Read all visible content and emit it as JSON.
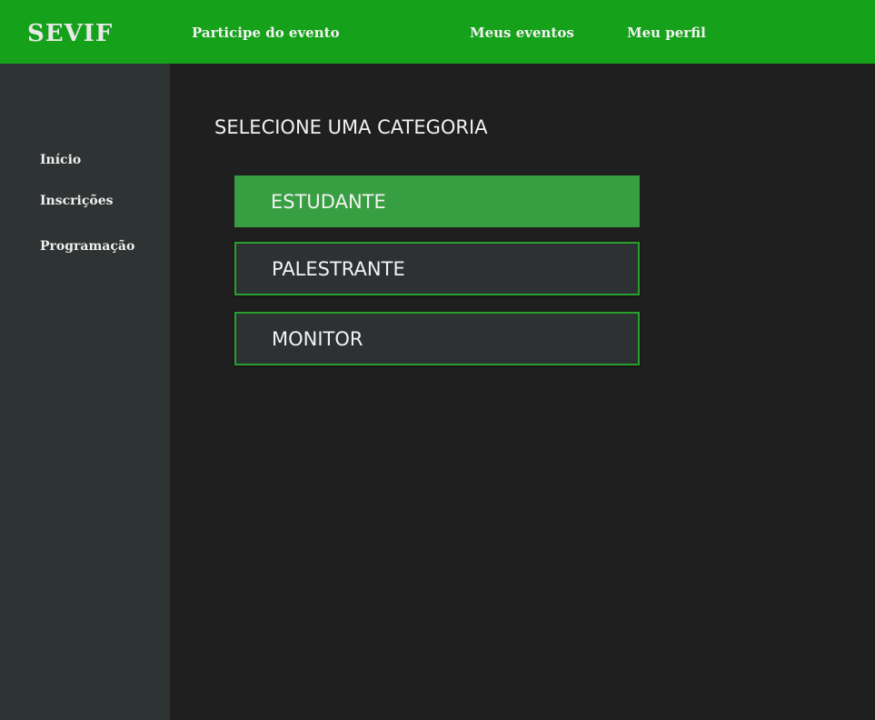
{
  "header": {
    "logo": "SEVIF",
    "nav": {
      "participe": "Participe do evento",
      "meus_eventos": "Meus eventos",
      "meu_perfil": "Meu perfil"
    }
  },
  "sidebar": {
    "items": [
      {
        "label": "Início"
      },
      {
        "label": "Inscrições"
      },
      {
        "label": "Programação"
      }
    ]
  },
  "main": {
    "title": "SELECIONE UMA CATEGORIA",
    "categories": [
      {
        "label": "ESTUDANTE",
        "selected": true
      },
      {
        "label": "PALESTRANTE",
        "selected": false
      },
      {
        "label": "MONITOR",
        "selected": false
      }
    ]
  },
  "colors": {
    "header_bg": "#15a11a",
    "sidebar_bg": "#2e3333",
    "main_bg": "#1f1f1f",
    "selected_bg": "#379e41",
    "outline_border": "#27a02c"
  }
}
